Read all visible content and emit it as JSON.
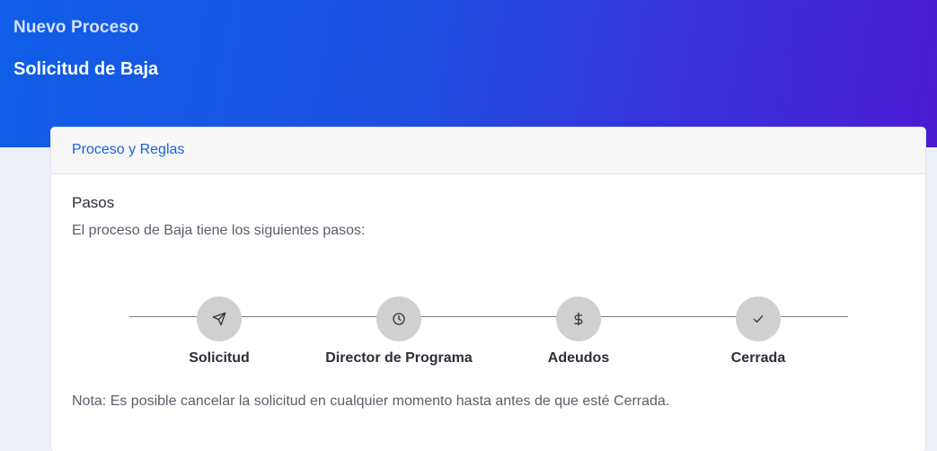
{
  "header": {
    "supertitle": "Nuevo Proceso",
    "title": "Solicitud de Baja"
  },
  "card": {
    "tab_label": "Proceso y Reglas",
    "section_title": "Pasos",
    "section_description": "El proceso de Baja tiene los siguientes pasos:",
    "steps": [
      {
        "label": "Solicitud",
        "icon": "send-icon"
      },
      {
        "label": "Director de Programa",
        "icon": "clock-icon"
      },
      {
        "label": "Adeudos",
        "icon": "dollar-icon"
      },
      {
        "label": "Cerrada",
        "icon": "check-icon"
      }
    ],
    "note": "Nota: Es posible cancelar la solicitud en cualquier momento hasta antes de que esté Cerrada."
  },
  "colors": {
    "hero_gradient_start": "#0f5ee8",
    "hero_gradient_end": "#4a1cd4",
    "tab_accent": "#1f5fd6",
    "step_circle": "#cfd0d2"
  }
}
